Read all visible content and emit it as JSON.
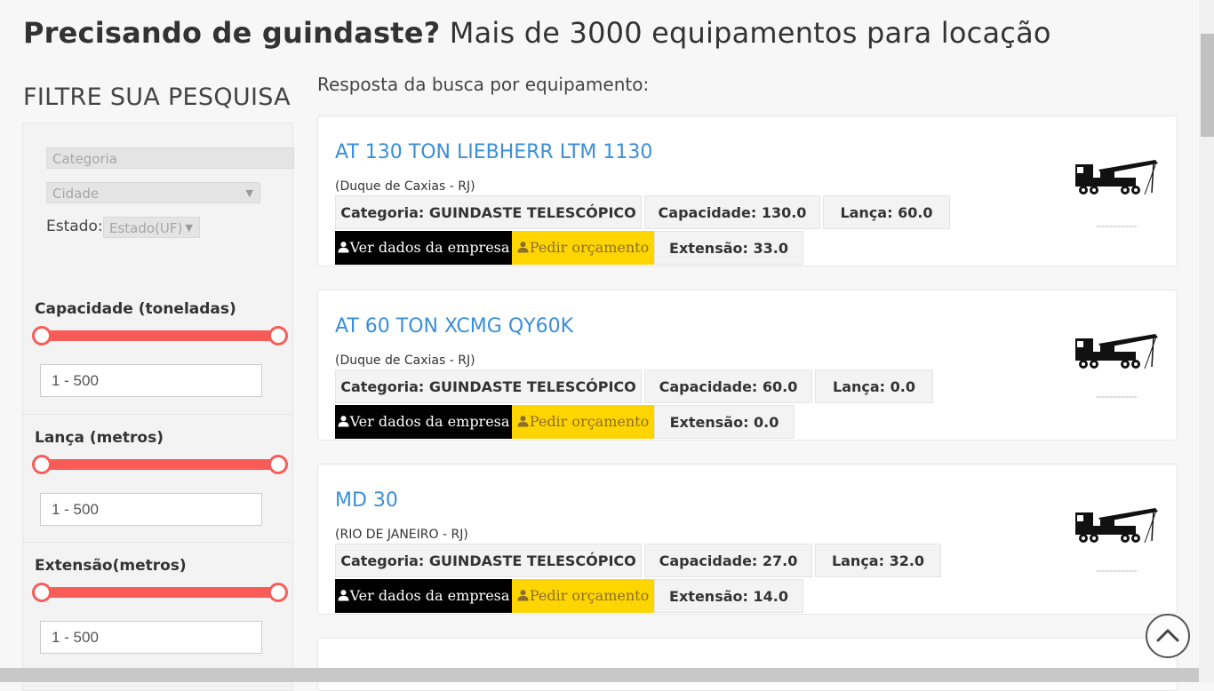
{
  "header": {
    "title_bold": "Precisando de guindaste?",
    "title_rest": " Mais de 3000 equipamentos para locação"
  },
  "filters": {
    "heading": "FILTRE SUA PESQUISA",
    "category_placeholder": "Categoria",
    "city_placeholder": "Cidade",
    "state_label": "Estado:",
    "state_placeholder": "Estado(UF)",
    "ranges": [
      {
        "label": "Capacidade (toneladas)",
        "value": "1 - 500",
        "min": 1,
        "max": 500
      },
      {
        "label": "Lança (metros)",
        "value": "1 - 500",
        "min": 1,
        "max": 500
      },
      {
        "label": "Extensão(metros)",
        "value": "1 - 500",
        "min": 1,
        "max": 500
      }
    ]
  },
  "results": {
    "heading": "Resposta da busca por equipamento:",
    "company_button": "Ver dados da empresa",
    "quote_button": "Pedir orçamento",
    "items": [
      {
        "title": "AT 130 TON LIEBHERR LTM 1130",
        "location": "(Duque de Caxias - RJ)",
        "category": "Categoria: GUINDASTE TELESCÓPICO",
        "capacity": "Capacidade: 130.0",
        "boom": "Lança: 60.0",
        "extension": "Extensão: 33.0"
      },
      {
        "title": "AT 60 TON XCMG QY60K",
        "location": "(Duque de Caxias - RJ)",
        "category": "Categoria: GUINDASTE TELESCÓPICO",
        "capacity": "Capacidade: 60.0",
        "boom": "Lança: 0.0",
        "extension": "Extensão: 0.0"
      },
      {
        "title": "MD 30",
        "location": "(RIO DE JANEIRO - RJ)",
        "category": "Categoria: GUINDASTE TELESCÓPICO",
        "capacity": "Capacidade: 27.0",
        "boom": "Lança: 32.0",
        "extension": "Extensão: 14.0"
      }
    ]
  },
  "colors": {
    "accent_link": "#3a8fd9",
    "slider": "#f85c58",
    "quote_button_bg": "#ffd500",
    "company_button_bg": "#000000"
  },
  "icons": [
    "user-icon",
    "chevron-up-icon",
    "caret-down-icon",
    "crane-truck-icon"
  ]
}
